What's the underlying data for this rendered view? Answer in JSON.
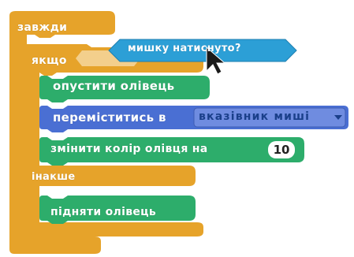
{
  "blocks": {
    "forever": {
      "label": "завжди"
    },
    "if_else": {
      "if_label": "якщо",
      "else_label": "інакше"
    },
    "mouse_down": {
      "label": "мишку натиснуто?"
    },
    "pen_down": {
      "label": "опустити олівець"
    },
    "go_to": {
      "label": "переміститись в",
      "target": "вказівник миші"
    },
    "change_color": {
      "label": "змінити колір олівця на",
      "value": "10"
    },
    "pen_up": {
      "label": "підняти олівець"
    }
  },
  "colors": {
    "control": "#e6a32a",
    "pen": "#2dad6b",
    "motion": "#4a6fd3",
    "sensing": "#2c9fd6",
    "dropdown": "#6f8ce0"
  }
}
